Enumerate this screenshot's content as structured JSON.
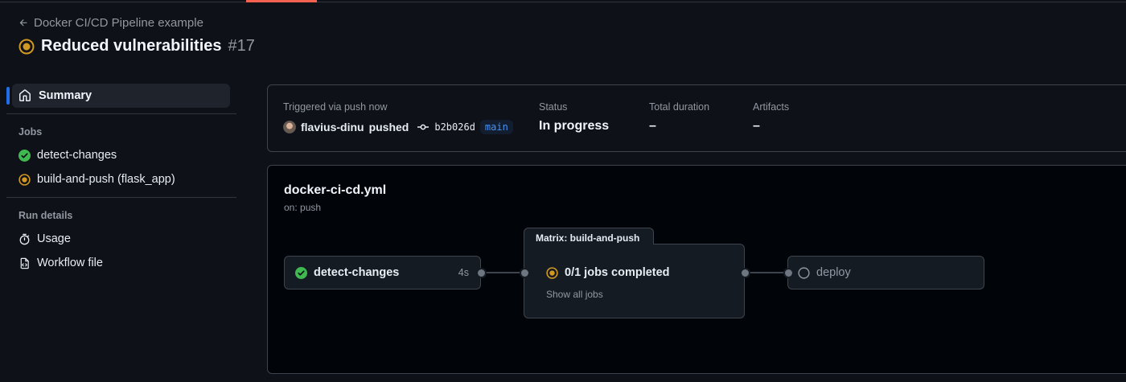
{
  "header": {
    "back_label": "Docker CI/CD Pipeline example",
    "run_title": "Reduced vulnerabilities",
    "run_number": "#17"
  },
  "sidebar": {
    "summary_label": "Summary",
    "jobs_heading": "Jobs",
    "jobs": [
      {
        "label": "detect-changes",
        "status": "success"
      },
      {
        "label": "build-and-push (flask_app)",
        "status": "in_progress"
      }
    ],
    "run_details_heading": "Run details",
    "details": [
      {
        "label": "Usage",
        "icon": "stopwatch-icon"
      },
      {
        "label": "Workflow file",
        "icon": "file-code-icon"
      }
    ]
  },
  "info": {
    "trigger_label": "Triggered via push now",
    "actor": "flavius-dinu",
    "action": "pushed",
    "commit_sha": "b2b026d",
    "branch": "main",
    "status_label": "Status",
    "status_value": "In progress",
    "duration_label": "Total duration",
    "duration_value": "–",
    "artifacts_label": "Artifacts",
    "artifacts_value": "–"
  },
  "workflow": {
    "file_name": "docker-ci-cd.yml",
    "trigger": "on: push",
    "jobs": {
      "detect": {
        "name": "detect-changes",
        "duration": "4s",
        "status": "success"
      },
      "matrix": {
        "tab_label": "Matrix: build-and-push",
        "status_text": "0/1 jobs completed",
        "show_all": "Show all jobs",
        "status": "in_progress"
      },
      "deploy": {
        "name": "deploy",
        "status": "queued"
      }
    }
  },
  "colors": {
    "success": "#3fb950",
    "in_progress": "#d29922",
    "accent": "#1f6feb",
    "branch_text": "#4493f8"
  }
}
